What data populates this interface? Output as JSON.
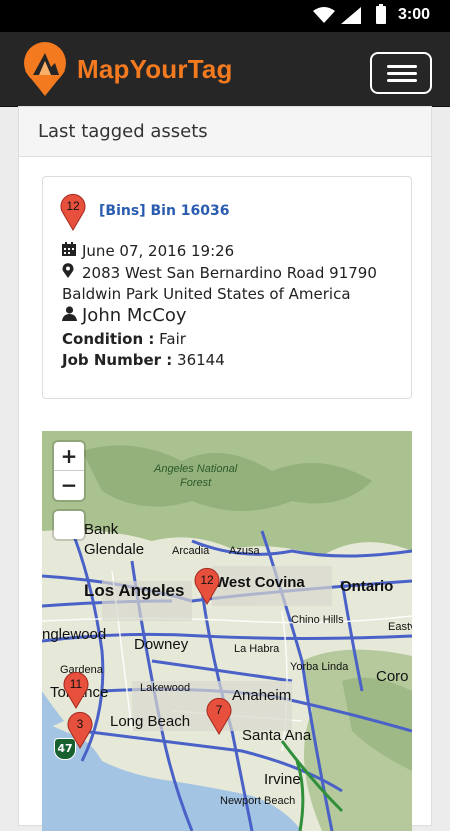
{
  "status_bar": {
    "time": "3:00"
  },
  "header": {
    "brand": "MapYourTag"
  },
  "panel": {
    "title": "Last tagged assets"
  },
  "asset": {
    "pin_number": "12",
    "category": "Bins",
    "name": "Bin 16036",
    "date": "June 07, 2016 19:26",
    "address_line1": "2083 West San Bernardino Road 91790",
    "address_line2": "Baldwin Park United States of America",
    "user": "John McCoy",
    "condition_label": "Condition :",
    "condition_value": "Fair",
    "job_label": "Job Number :",
    "job_value": "36144"
  },
  "map": {
    "zoom_in": "+",
    "zoom_out": "−",
    "labels": {
      "forest1": "Angeles National",
      "forest2": "Forest",
      "burbank": "Bank",
      "glendale": "Glendale",
      "arcadia": "Arcadia",
      "azusa": "Azusa",
      "los_angeles": "Los Angeles",
      "west_covina": "West Covina",
      "ontario": "Ontario",
      "chino_hills": "Chino Hills",
      "eastvale": "Eastv",
      "inglewood": "nglewood",
      "downey": "Downey",
      "la_habra": "La Habra",
      "yorba_linda": "Yorba Linda",
      "corona": "Coro",
      "gardena": "Gardena",
      "torrance": "Torrance",
      "lakewood": "Lakewood",
      "anaheim": "Anaheim",
      "long_beach": "Long Beach",
      "santa_ana": "Santa Ana",
      "irvine": "Irvine",
      "newport": "Newport Beach",
      "shield": "47"
    },
    "markers": [
      "12",
      "11",
      "3",
      "7"
    ]
  },
  "colors": {
    "brand_orange": "#f47a20",
    "marker_red": "#e8503e",
    "link_blue": "#2a5db0"
  }
}
